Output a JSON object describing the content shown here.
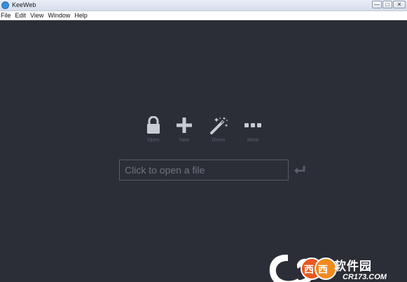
{
  "window": {
    "title": "KeeWeb",
    "controls": {
      "minimize": "—",
      "maximize": "□",
      "close": "✕"
    }
  },
  "menu": [
    "File",
    "Edit",
    "View",
    "Window",
    "Help"
  ],
  "actions": [
    {
      "id": "open",
      "label": "Open",
      "icon": "lock-icon"
    },
    {
      "id": "new",
      "label": "New",
      "icon": "plus-icon"
    },
    {
      "id": "demo",
      "label": "Demo",
      "icon": "magic-wand-icon"
    },
    {
      "id": "more",
      "label": "More",
      "icon": "more-dots-icon"
    }
  ],
  "file_input": {
    "placeholder": "Click to open a file",
    "value": ""
  },
  "enter_icon": "enter-arrow-icon",
  "watermark": {
    "text": "软件园",
    "url": "CR173.COM"
  },
  "colors": {
    "background": "#2b2e36",
    "icon": "#c8cbd1",
    "label": "#5c606b",
    "input_border": "#585c66"
  }
}
